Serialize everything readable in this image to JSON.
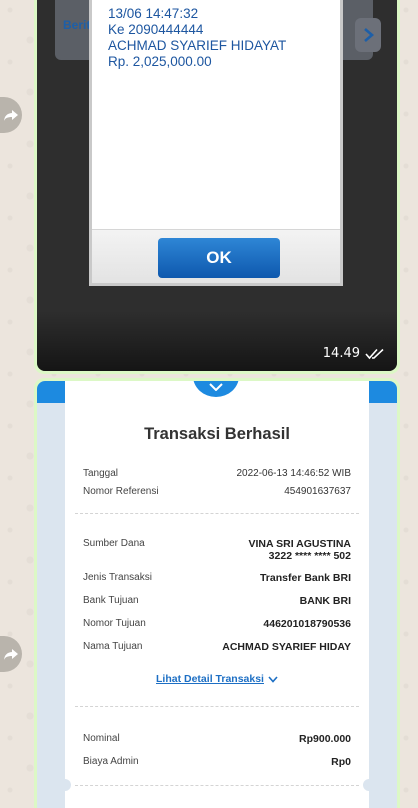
{
  "message1": {
    "banner_text": "Berit",
    "dialog_lines": [
      "13/06 14:47:32",
      "Ke 2090444444",
      "ACHMAD SYARIEF HIDAYAT",
      "Rp. 2,025,000.00"
    ],
    "ok_label": "OK",
    "time": "14.49"
  },
  "message2": {
    "receipt": {
      "title": "Transaksi Berhasil",
      "rows1": [
        {
          "label": "Tanggal",
          "value": "2022-06-13 14:46:52 WIB"
        },
        {
          "label": "Nomor Referensi",
          "value": "454901637637"
        }
      ],
      "source": {
        "label": "Sumber Dana",
        "name": "VINA SRI AGUSTINA",
        "account": "3222 **** **** 502"
      },
      "rows2": [
        {
          "label": "Jenis Transaksi",
          "value": "Transfer Bank BRI"
        },
        {
          "label": "Bank Tujuan",
          "value": "BANK BRI"
        },
        {
          "label": "Nomor Tujuan",
          "value": "446201018790536"
        },
        {
          "label": "Nama Tujuan",
          "value": "ACHMAD SYARIEF HIDAY"
        }
      ],
      "detail_link": "Lihat Detail Transaksi",
      "rows3": [
        {
          "label": "Nominal",
          "value": "Rp900.000"
        },
        {
          "label": "Biaya Admin",
          "value": "Rp0"
        }
      ]
    }
  },
  "colors": {
    "bubble": "#dcf8c6",
    "bri_blue": "#1d8ae0",
    "link_blue": "#1d6fc4"
  }
}
